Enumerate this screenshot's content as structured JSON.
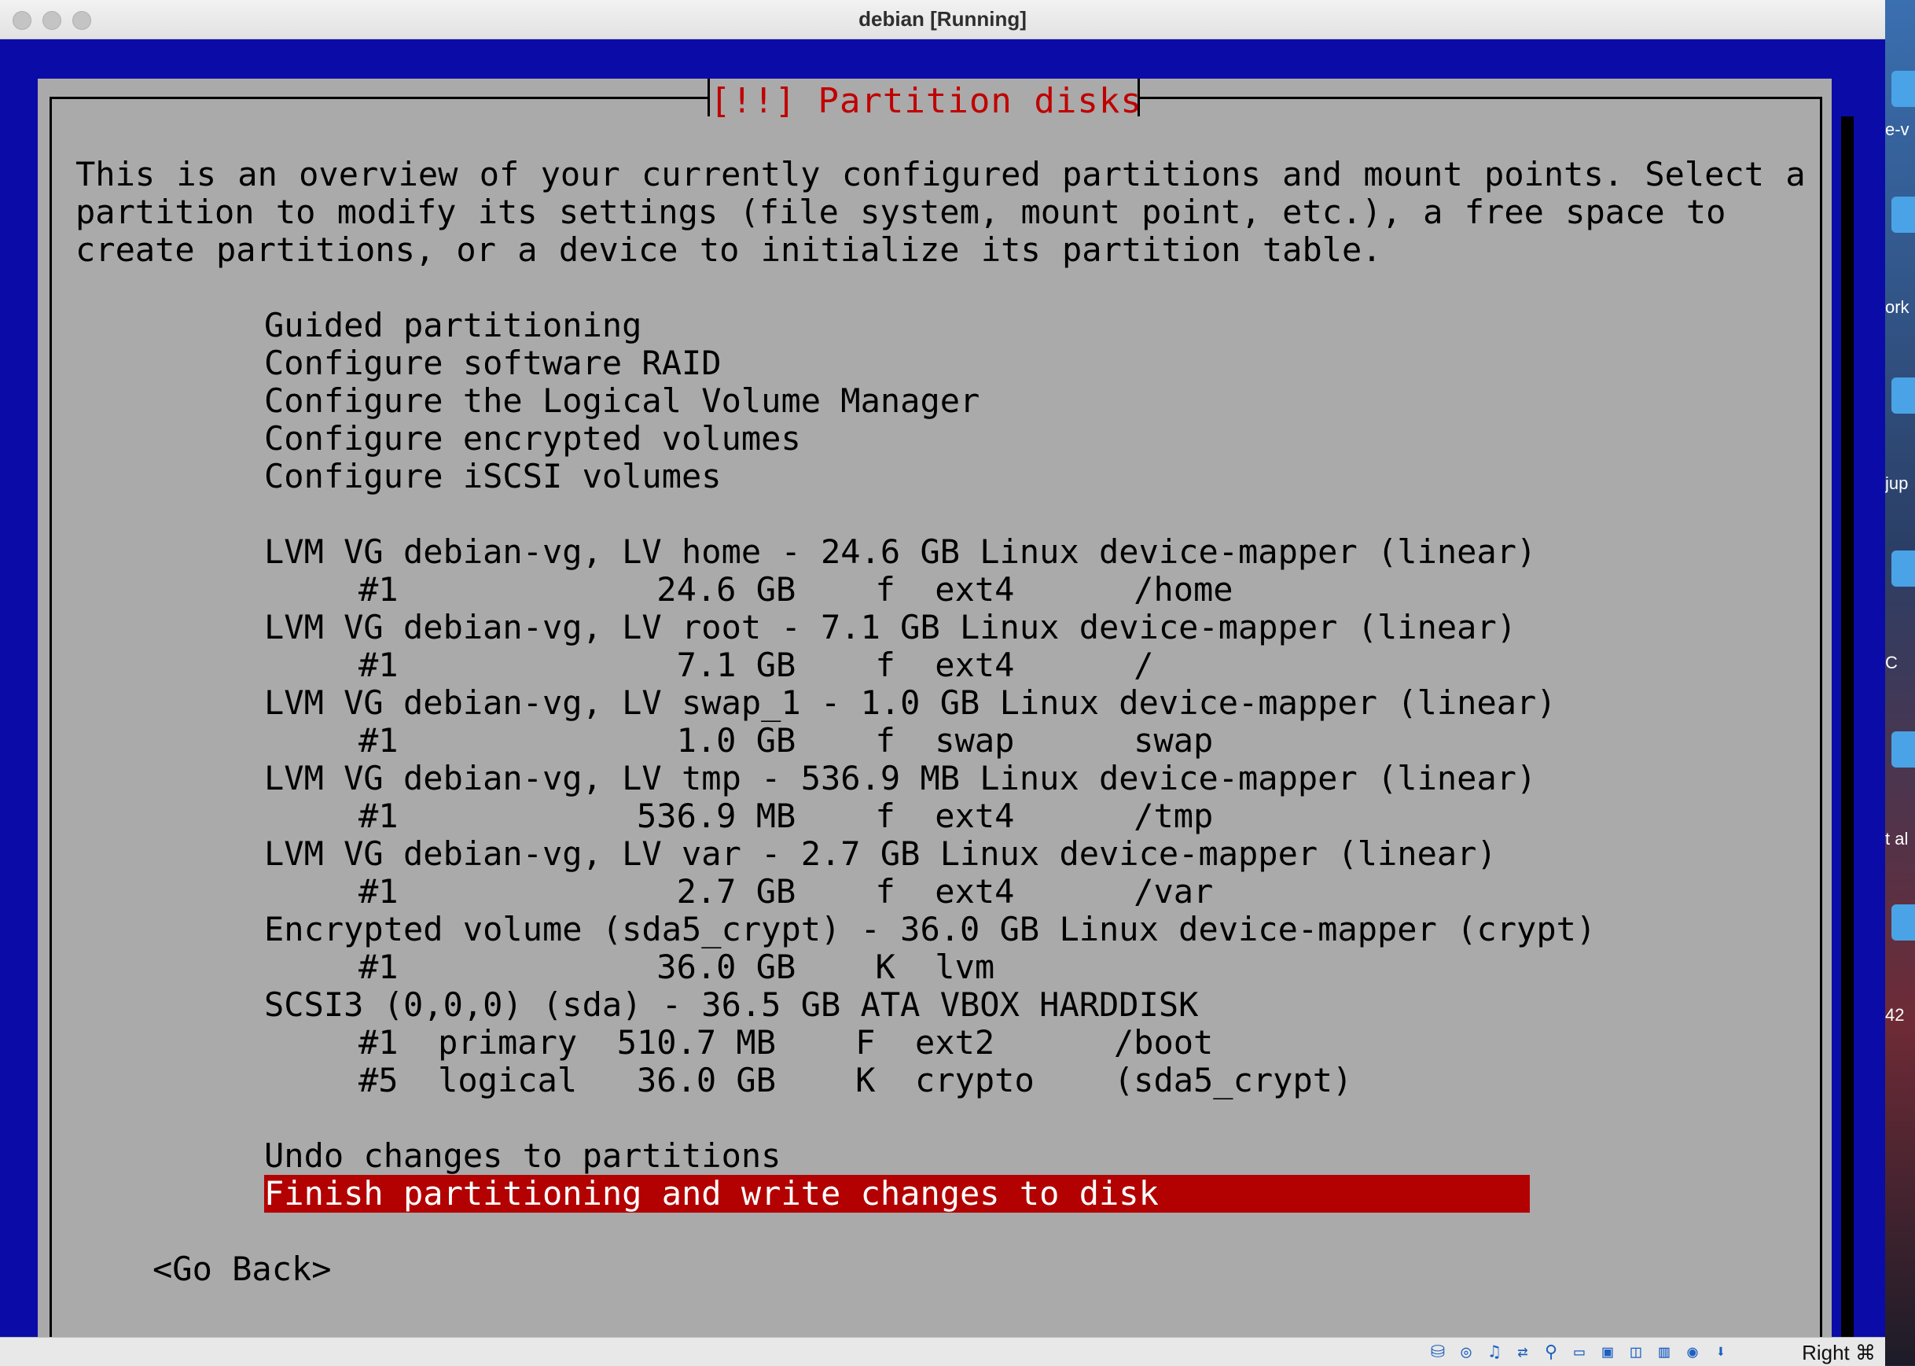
{
  "window": {
    "title": "debian [Running]"
  },
  "dialog": {
    "title": "[!!] Partition disks",
    "intro": "This is an overview of your currently configured partitions and mount points. Select a partition to modify its settings (file system, mount point, etc.), a free space to create partitions, or a device to initialize its partition table.",
    "menu": [
      {
        "text": "Guided partitioning"
      },
      {
        "text": "Configure software RAID"
      },
      {
        "text": "Configure the Logical Volume Manager"
      },
      {
        "text": "Configure encrypted volumes"
      },
      {
        "text": "Configure iSCSI volumes"
      },
      {
        "text": ""
      },
      {
        "text": "LVM VG debian-vg, LV home - 24.6 GB Linux device-mapper (linear)"
      },
      {
        "text": "#1             24.6 GB    f  ext4      /home"
      },
      {
        "text": "LVM VG debian-vg, LV root - 7.1 GB Linux device-mapper (linear)"
      },
      {
        "text": "#1              7.1 GB    f  ext4      /"
      },
      {
        "text": "LVM VG debian-vg, LV swap_1 - 1.0 GB Linux device-mapper (linear)"
      },
      {
        "text": "#1              1.0 GB    f  swap      swap"
      },
      {
        "text": "LVM VG debian-vg, LV tmp - 536.9 MB Linux device-mapper (linear)"
      },
      {
        "text": "#1            536.9 MB    f  ext4      /tmp"
      },
      {
        "text": "LVM VG debian-vg, LV var - 2.7 GB Linux device-mapper (linear)"
      },
      {
        "text": "#1              2.7 GB    f  ext4      /var"
      },
      {
        "text": "Encrypted volume (sda5_crypt) - 36.0 GB Linux device-mapper (crypt)"
      },
      {
        "text": "#1             36.0 GB    K  lvm"
      },
      {
        "text": "SCSI3 (0,0,0) (sda) - 36.5 GB ATA VBOX HARDDISK"
      },
      {
        "text": "#1  primary  510.7 MB    F  ext2      /boot"
      },
      {
        "text": "#5  logical   36.0 GB    K  crypto    (sda5_crypt)"
      },
      {
        "text": ""
      },
      {
        "text": "Undo changes to partitions"
      },
      {
        "text": "Finish partitioning and write changes to disk"
      }
    ],
    "go_back": "<Go Back>"
  },
  "statusbar": {
    "host_key": "Right ⌘"
  },
  "desktop": {
    "labels": [
      "e-v",
      "ork",
      "jup",
      "C",
      "t al",
      "42"
    ]
  }
}
